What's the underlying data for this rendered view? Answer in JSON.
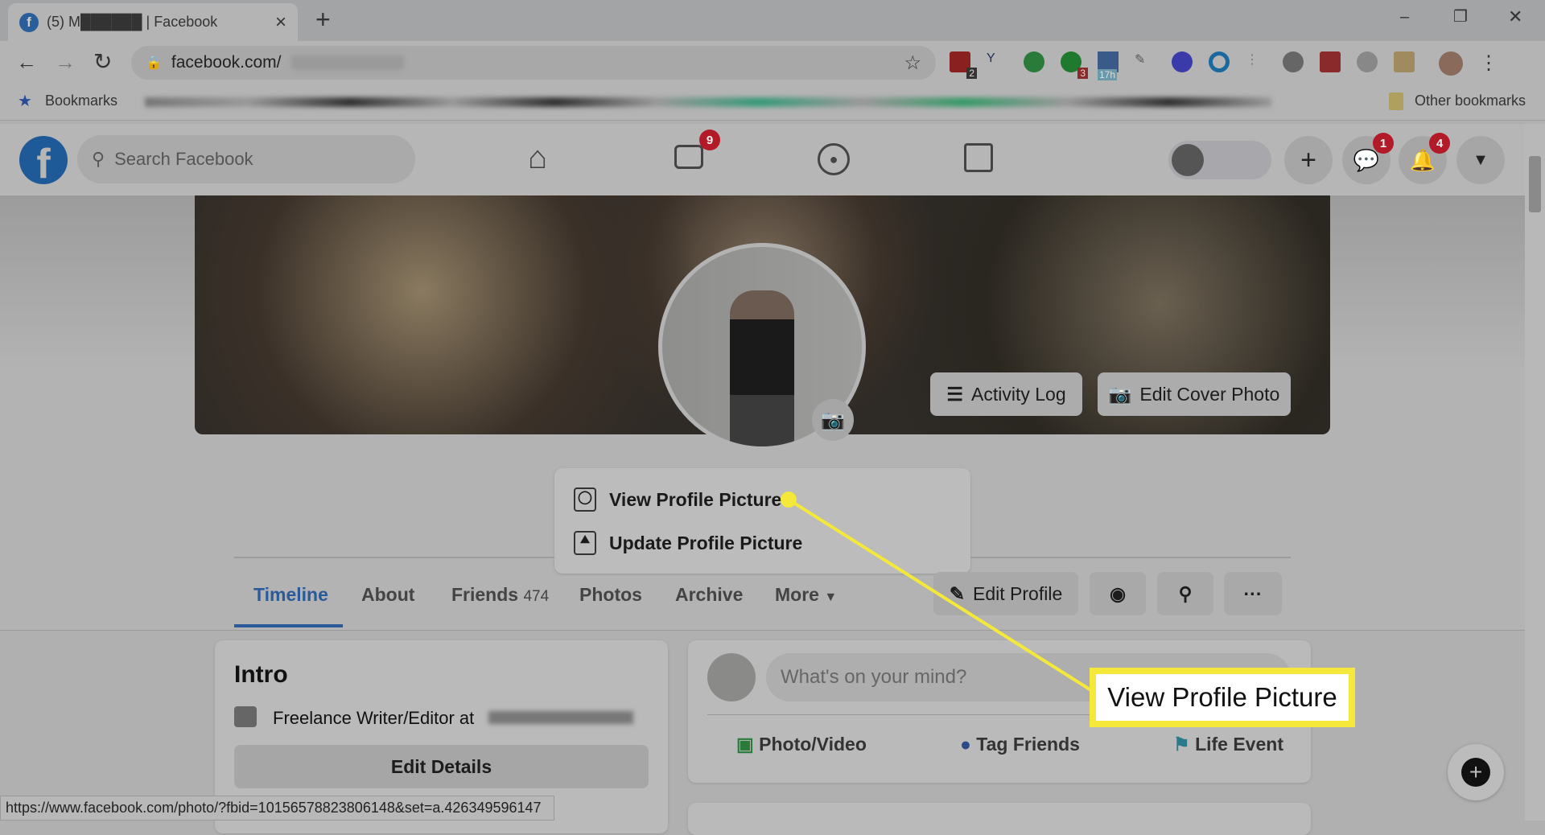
{
  "browser": {
    "tab_title": "(5) M██████ | Facebook",
    "tab_close": "×",
    "new_tab": "+",
    "window_controls": [
      "–",
      "❐",
      "✕"
    ],
    "url": "facebook.com/",
    "extension_badges": [
      "2",
      "3",
      "17h"
    ],
    "bookmarks_label": "Bookmarks",
    "other_bookmarks": "Other bookmarks",
    "status_url": "https://www.facebook.com/photo/?fbid=10156578823806148&set=a.426349596147"
  },
  "facebook": {
    "brand_color": "#1877f2",
    "search_placeholder": "Search Facebook",
    "watch_badge": "9",
    "messenger_badge": "1",
    "notifications_badge": "4",
    "cover_buttons": {
      "activity_log": "Activity Log",
      "edit_cover": "Edit Cover Photo"
    },
    "profile_menu": [
      {
        "label": "View Profile Picture",
        "icon": "person-icon"
      },
      {
        "label": "Update Profile Picture",
        "icon": "image-icon"
      }
    ],
    "nav_tabs": [
      {
        "label": "Timeline",
        "active": true
      },
      {
        "label": "About"
      },
      {
        "label": "Friends",
        "count": "474"
      },
      {
        "label": "Photos"
      },
      {
        "label": "Archive"
      },
      {
        "label": "More"
      }
    ],
    "edit_profile": "Edit Profile",
    "intro": {
      "title": "Intro",
      "work": "Freelance Writer/Editor at",
      "edit_details": "Edit Details"
    },
    "composer": {
      "placeholder": "What's on your mind?",
      "actions": [
        "Photo/Video",
        "Tag Friends",
        "Life Event"
      ]
    }
  },
  "callout": {
    "label": "View Profile Picture",
    "color": "#f5e83a"
  }
}
